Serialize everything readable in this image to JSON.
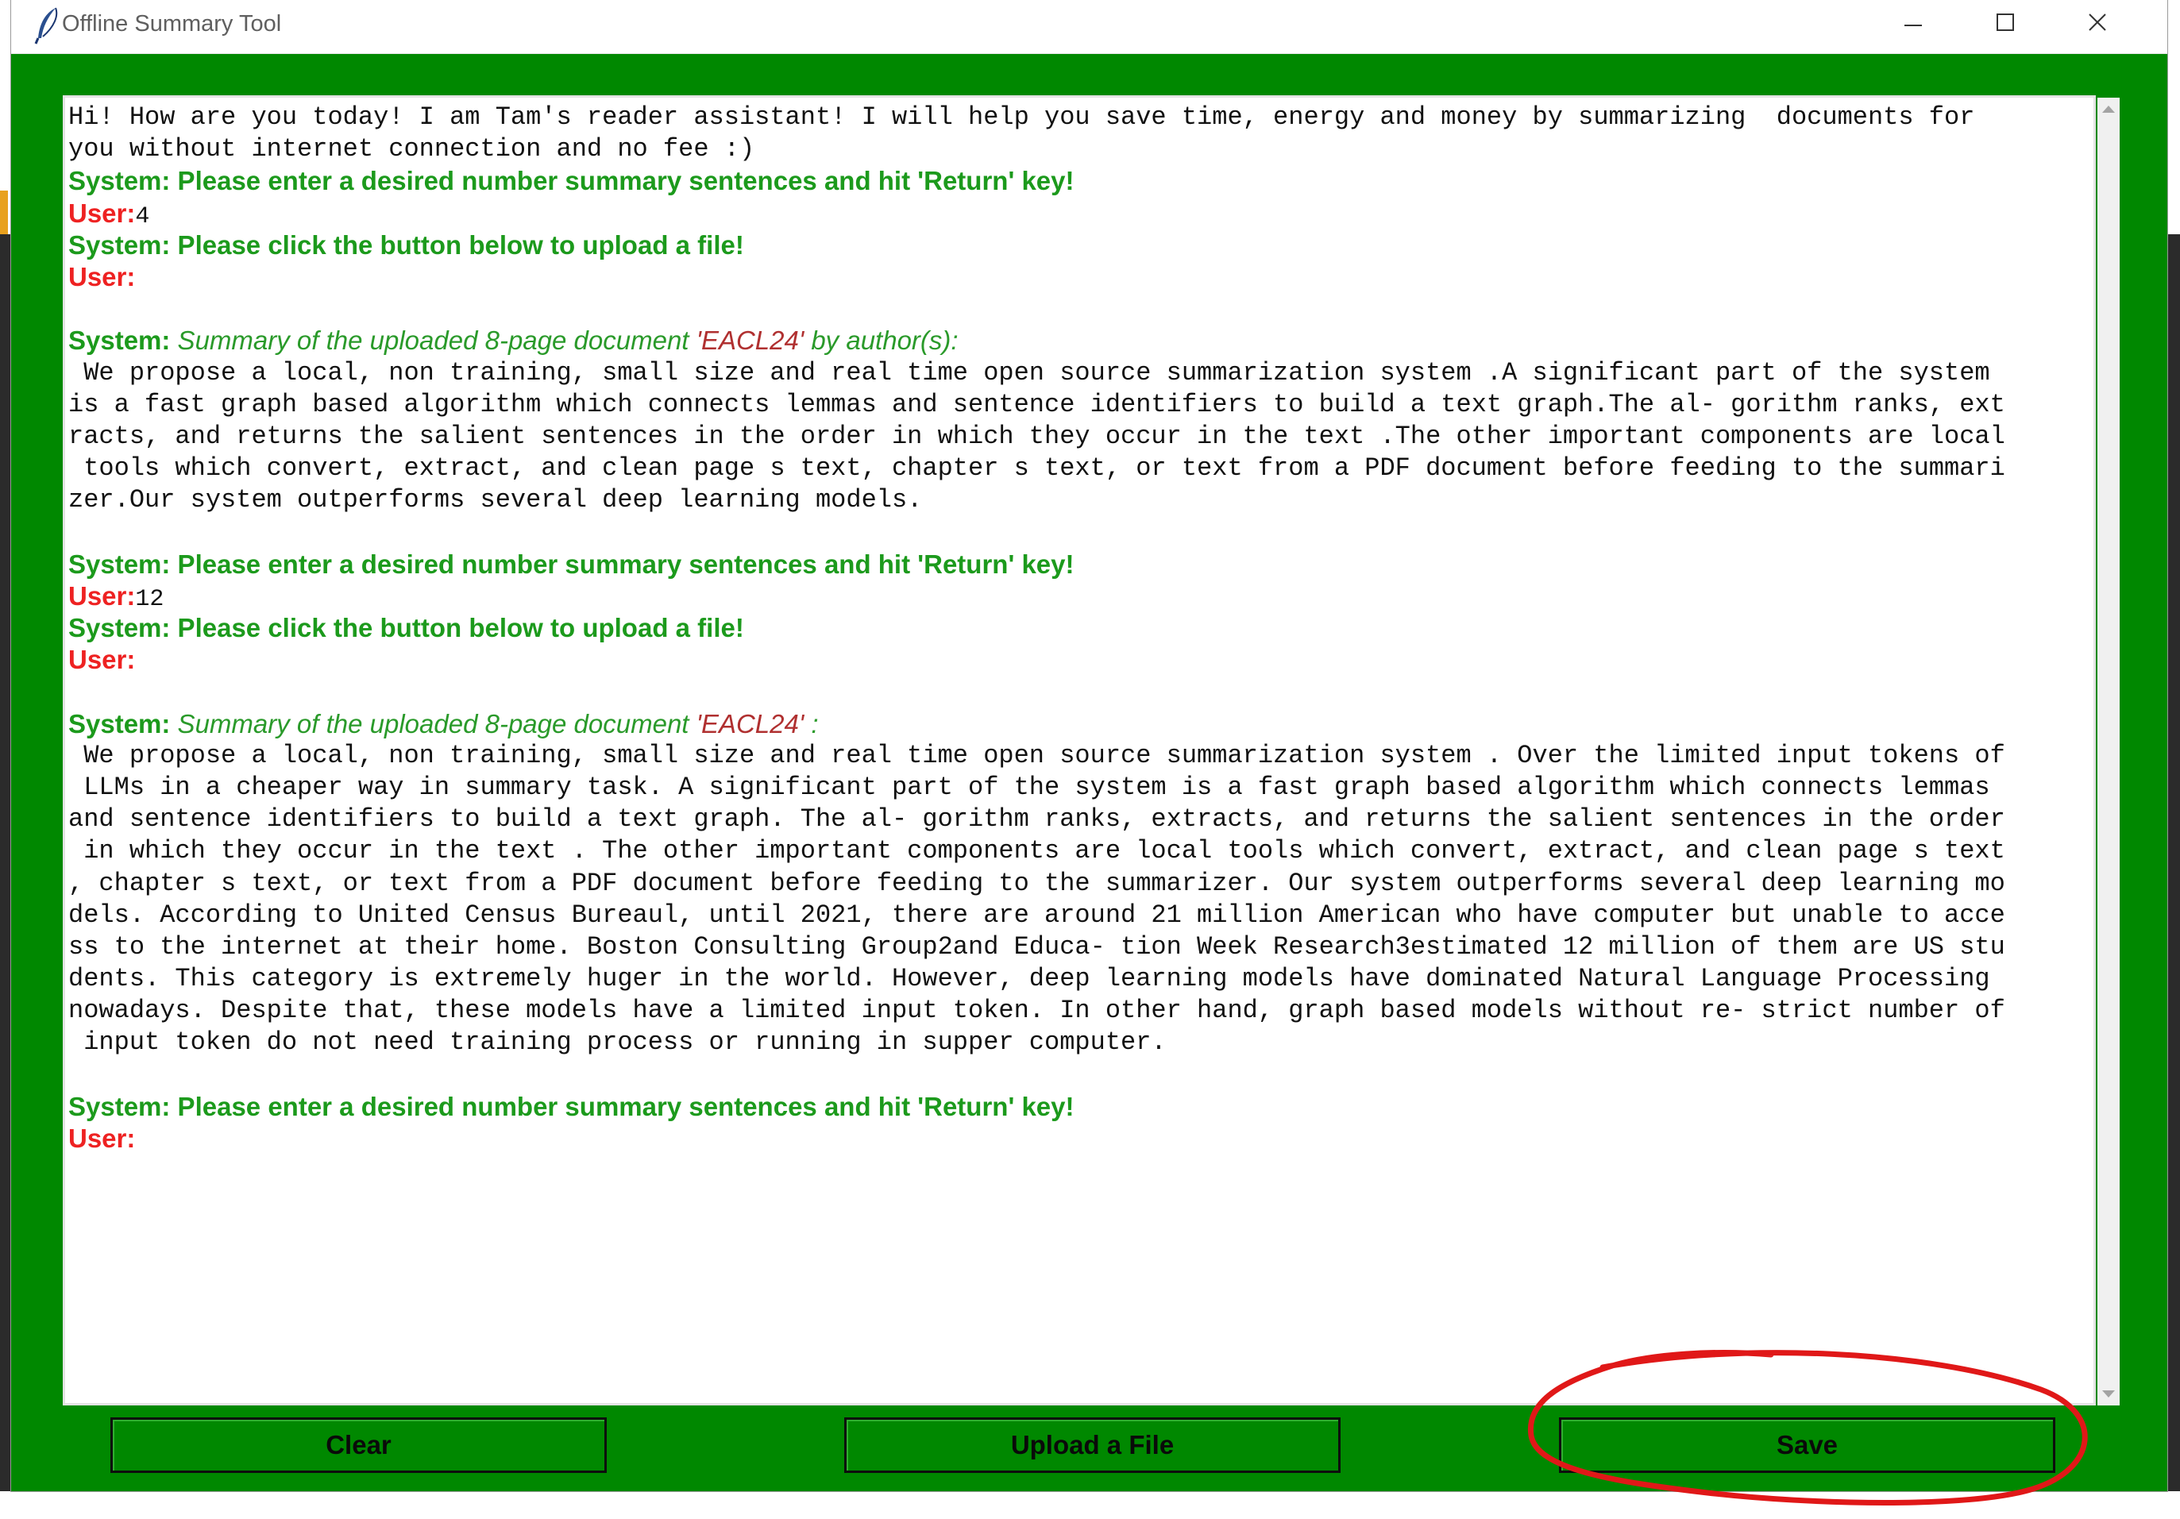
{
  "window": {
    "title": "Offline Summary Tool",
    "app_icon": "feather-icon",
    "controls": [
      "minimize-icon",
      "maximize-icon",
      "close-icon"
    ]
  },
  "colors": {
    "window_bg": "#008800",
    "system_text": "#1c9a1c",
    "user_label": "#ee2222",
    "doc_name": "#b03030",
    "annotation_circle": "#e01818"
  },
  "transcript": {
    "intro_1": "Hi! How are you today! I am Tam's reader assistant! I will help you save time, energy and money by summarizing  documents for",
    "intro_2": "you without internet connection and no fee :)",
    "sys_number_prompt": "System: Please enter a desired number summary sentences and hit 'Return' key!",
    "user_label": "User:",
    "user_value_1": "4",
    "sys_upload_prompt": "System: Please click the button below to upload a file!",
    "system_label": "System:",
    "summary1_prefix": " Summary of the uploaded 8-page document ",
    "summary1_docname": "'EACL24'",
    "summary1_suffix": " by author(s):",
    "summary1_lines": [
      " We propose a local, non training, small size and real time open source summarization system .A significant part of the system",
      "is a fast graph based algorithm which connects lemmas and sentence identifiers to build a text graph.The al- gorithm ranks, ext",
      "racts, and returns the salient sentences in the order in which they occur in the text .The other important components are local",
      " tools which convert, extract, and clean page s text, chapter s text, or text from a PDF document before feeding to the summari",
      "zer.Our system outperforms several deep learning models."
    ],
    "user_value_2": "12",
    "summary2_prefix": " Summary of the uploaded 8-page document ",
    "summary2_docname": "'EACL24'",
    "summary2_suffix": " :",
    "summary2_lines": [
      " We propose a local, non training, small size and real time open source summarization system . Over the limited input tokens of",
      " LLMs in a cheaper way in summary task. A significant part of the system is a fast graph based algorithm which connects lemmas",
      "and sentence identifiers to build a text graph. The al- gorithm ranks, extracts, and returns the salient sentences in the order",
      " in which they occur in the text . The other important components are local tools which convert, extract, and clean page s text",
      ", chapter s text, or text from a PDF document before feeding to the summarizer. Our system outperforms several deep learning mo",
      "dels. According to United Census Bureaul, until 2021, there are around 21 million American who have computer but unable to acce",
      "ss to the internet at their home. Boston Consulting Group2and Educa- tion Week Research3estimated 12 million of them are US stu",
      "dents. This category is extremely huger in the world. However, deep learning models have dominated Natural Language Processing",
      "nowadays. Despite that, these models have a limited input token. In other hand, graph based models without re- strict number of",
      " input token do not need training process or running in supper computer."
    ]
  },
  "buttons": {
    "clear": "Clear",
    "upload": "Upload a File",
    "save": "Save"
  },
  "annotation": {
    "type": "hand-drawn circle",
    "target": "Save"
  }
}
